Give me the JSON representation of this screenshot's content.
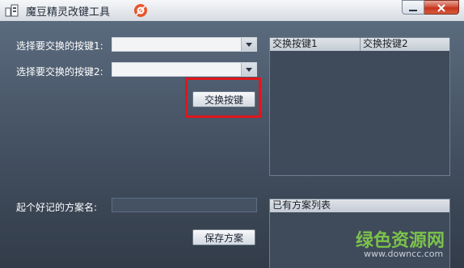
{
  "window": {
    "title": "魔豆精灵改键工具"
  },
  "form": {
    "key1_label": "选择要交换的按键1:",
    "key1_value": "",
    "key2_label": "选择要交换的按键2:",
    "key2_value": "",
    "swap_button": "交换按键",
    "scheme_name_label": "起个好记的方案名:",
    "scheme_name_value": "",
    "save_button": "保存方案"
  },
  "swap_table": {
    "columns": [
      "交换按键1",
      "交换按键2"
    ],
    "rows": []
  },
  "scheme_list": {
    "header": "已有方案列表",
    "items": []
  },
  "watermark": {
    "brand": "绿色资源网",
    "url": "www.downcc.com"
  },
  "colors": {
    "highlight": "#e0161c",
    "watermark": "#7cc24a"
  },
  "icons": [
    "app-icon",
    "help-icon",
    "minimize-icon",
    "close-icon",
    "dropdown-arrow-icon"
  ]
}
